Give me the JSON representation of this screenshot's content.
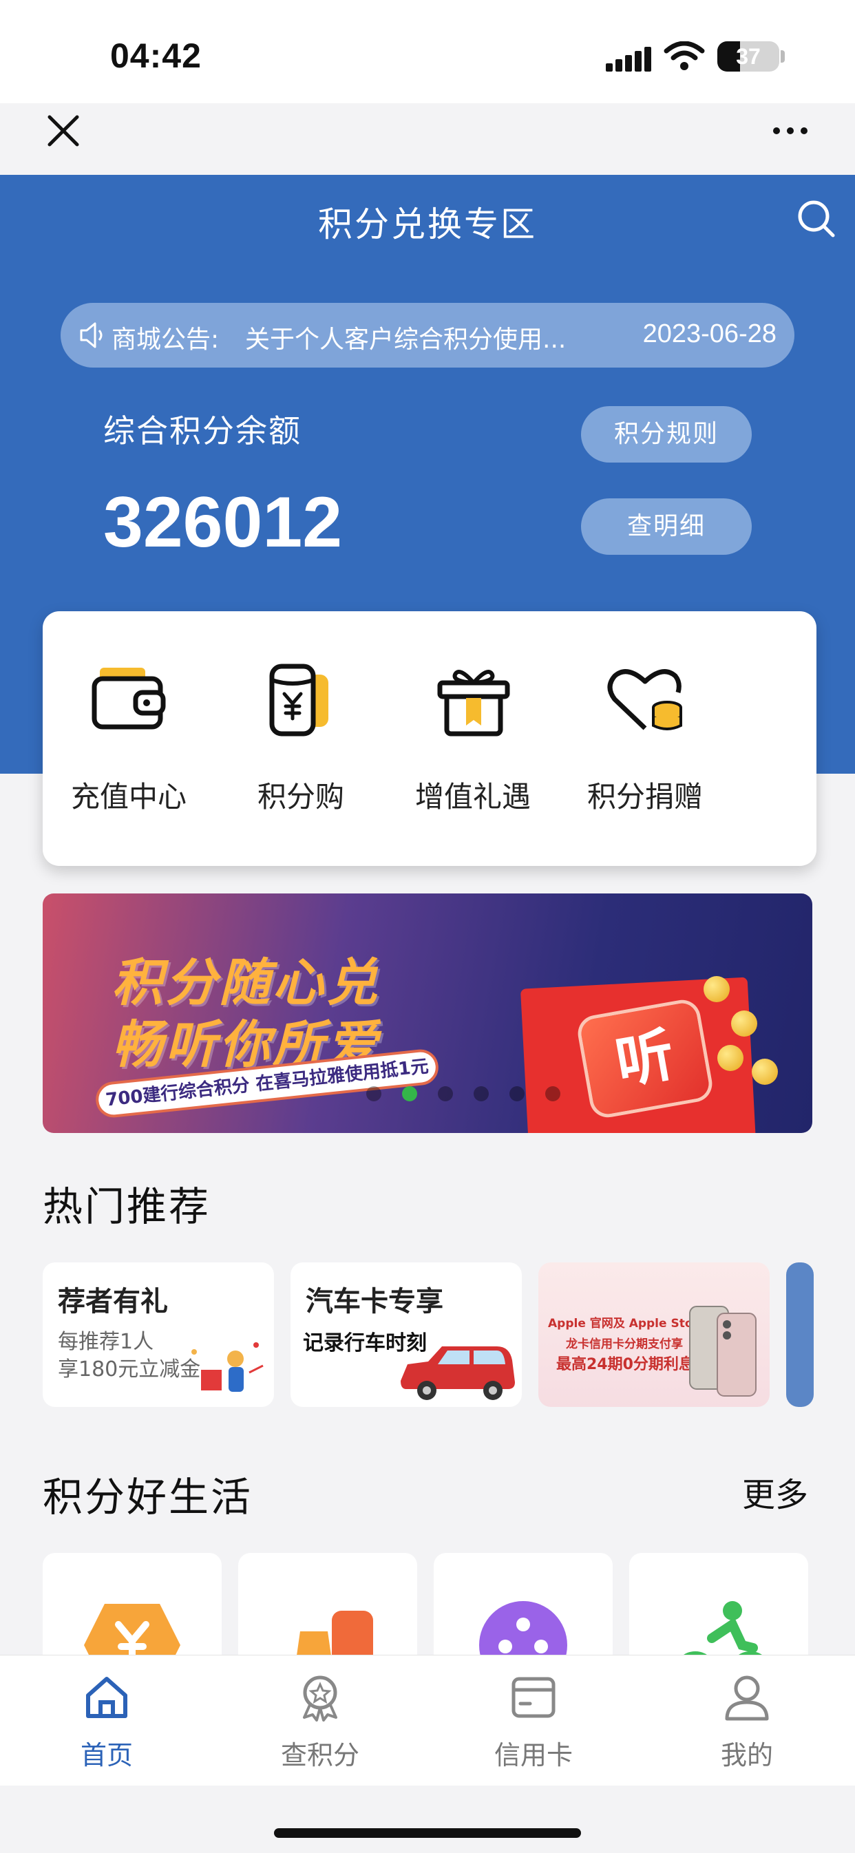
{
  "status_bar": {
    "time": "04:42",
    "battery": "37",
    "battery_level": 0.37
  },
  "header": {
    "title": "积分兑换专区"
  },
  "notice": {
    "label": "商城公告:",
    "message": "关于个人客户综合积分使用...",
    "date": "2023-06-28"
  },
  "balance": {
    "label": "综合积分余额",
    "value": "326012",
    "rules_button": "积分规则",
    "detail_button": "查明细"
  },
  "actions": [
    {
      "label": "充值中心",
      "icon": "wallet-icon"
    },
    {
      "label": "积分购",
      "icon": "yuan-cup-icon"
    },
    {
      "label": "增值礼遇",
      "icon": "gift-icon"
    },
    {
      "label": "积分捐赠",
      "icon": "heart-coins-icon"
    }
  ],
  "banner": {
    "line1": "积分随心兑",
    "line2": "畅听你所爱",
    "strap": "700建行综合积分 在喜马拉雅使用抵1元",
    "logo_text": "听",
    "carousel": {
      "count": 6,
      "active_index": 1
    }
  },
  "hot": {
    "title": "热门推荐",
    "cards": [
      {
        "title": "荐者有礼",
        "subtitle_line1": "每推荐1人",
        "subtitle_line2": "享180元立减金"
      },
      {
        "title": "汽车卡专享",
        "subtitle": "记录行车时刻"
      },
      {
        "line1": "Apple 官网及 Apple Store 零售店",
        "line2": "龙卡信用卡分期支付享",
        "line3": "最高24期0分期利息"
      }
    ]
  },
  "life": {
    "title": "积分好生活",
    "more": "更多"
  },
  "colors": {
    "primary": "#346bbb",
    "accent_tab": "#2b62b7"
  },
  "tabbar": [
    {
      "label": "首页",
      "icon": "home-icon",
      "active": true
    },
    {
      "label": "查积分",
      "icon": "badge-icon",
      "active": false
    },
    {
      "label": "信用卡",
      "icon": "card-icon",
      "active": false
    },
    {
      "label": "我的",
      "icon": "user-icon",
      "active": false
    }
  ]
}
